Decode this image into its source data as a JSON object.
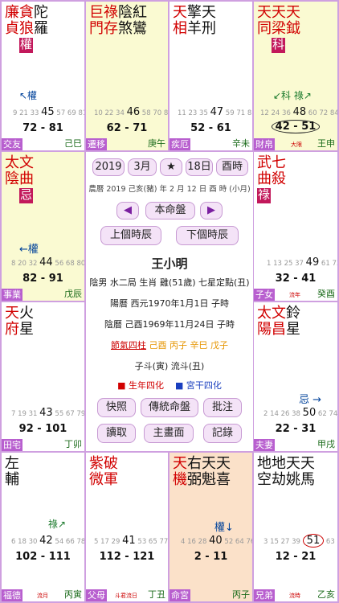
{
  "cells": {
    "top0": {
      "stars_top": [
        [
          "廉",
          "貞"
        ],
        [
          "貪",
          "狼",
          "權"
        ],
        [
          "陀",
          "羅"
        ]
      ],
      "arrow": "↖權",
      "ages": [
        "9",
        "21",
        "33",
        "45",
        "57",
        "69",
        "81"
      ],
      "range": "72 - 81",
      "palace": "交友",
      "gz": "己巳"
    },
    "top1": {
      "arrow": "",
      "ages": [
        "10",
        "22",
        "34",
        "46",
        "58",
        "70",
        "82"
      ],
      "range": "62 - 71",
      "palace": "遷移",
      "gz": "庚午"
    },
    "top2": {
      "ages": [
        "11",
        "23",
        "35",
        "47",
        "59",
        "71",
        "83"
      ],
      "range": "52 - 61",
      "palace": "疾厄",
      "gz": "辛未"
    },
    "top3": {
      "arrow": "↙科 祿↗",
      "ages": [
        "12",
        "24",
        "36",
        "48",
        "60",
        "72",
        "84"
      ],
      "range": "42 - 51",
      "palace": "財帛",
      "gz": "王申",
      "tag": "大限"
    },
    "left1": {
      "arrow": "←權",
      "ages": [
        "8",
        "20",
        "32",
        "44",
        "56",
        "68",
        "80"
      ],
      "range": "82 - 91",
      "palace": "事業",
      "gz": "戊辰"
    },
    "right1": {
      "ages": [
        "1",
        "13",
        "25",
        "37",
        "49",
        "61",
        "73"
      ],
      "range": "32 - 41",
      "palace": "子女",
      "gz": "癸酉",
      "tag": "流年"
    },
    "left2": {
      "ages": [
        "7",
        "19",
        "31",
        "43",
        "55",
        "67",
        "79"
      ],
      "range": "92 - 101",
      "palace": "田宅",
      "gz": "丁卯"
    },
    "right2": {
      "arrow": "忌 →",
      "ages": [
        "2",
        "14",
        "26",
        "38",
        "50",
        "62",
        "74"
      ],
      "range": "22 - 31",
      "palace": "夫妻",
      "gz": "甲戌"
    },
    "bot0": {
      "arrow": "祿↗",
      "ages": [
        "6",
        "18",
        "30",
        "42",
        "54",
        "66",
        "78"
      ],
      "range": "102 - 111",
      "palace": "福德",
      "gz": "丙寅",
      "tag": "流月"
    },
    "bot1": {
      "ages": [
        "5",
        "17",
        "29",
        "41",
        "53",
        "65",
        "77"
      ],
      "range": "112 - 121",
      "palace": "父母",
      "gz": "丁丑",
      "tag": "斗君流日"
    },
    "bot2": {
      "arrow": "權↓",
      "ages": [
        "4",
        "16",
        "28",
        "40",
        "52",
        "64",
        "76"
      ],
      "range": "2 - 11",
      "palace": "命宮",
      "gz": "丙子"
    },
    "bot3": {
      "ages": [
        "3",
        "15",
        "27",
        "39",
        "51",
        "63",
        "75"
      ],
      "range": "12 - 21",
      "palace": "兄弟",
      "gz": "乙亥",
      "tag": "流時"
    }
  },
  "center": {
    "year": "2019",
    "month": "3月",
    "star": "★",
    "day": "18日",
    "hour": "酉時",
    "lunar": "農曆 2019 己亥(豬) 年 2 月 12 日 酉 時 (小月)",
    "prev": "◀",
    "main": "本命盤",
    "next": "▶",
    "prev_hour": "上個時辰",
    "next_hour": "下個時辰",
    "name": "王小明",
    "info": "陰男 水二局 生肖 雞(51歲) 七星定點(丑)",
    "solar": "陽曆 西元1970年1月1日 子時",
    "lunar_birth": "陰曆 己酉1969年11月24日 子時",
    "pillars_label": "節氣四柱",
    "pillars": "己酉 丙子 辛巳 戊子",
    "ziwei": "子斗(寅) 流斗(丑)",
    "legend_a": "生年四化",
    "legend_b": "宮干四化",
    "btn1": "快照",
    "btn2": "傳統命盤",
    "btn3": "批注",
    "btn4": "讀取",
    "btn5": "主畫面",
    "btn6": "記錄"
  },
  "colors": {
    "accent": "#b85fcf",
    "red": "#d10000",
    "blue": "#1a3fbf"
  }
}
